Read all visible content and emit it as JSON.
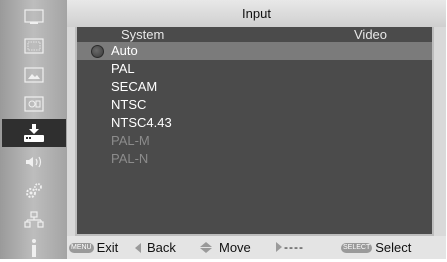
{
  "window": {
    "title": "Input"
  },
  "columns": {
    "system": "System",
    "video": "Video"
  },
  "sidebar": {
    "items": [
      {
        "icon": "display-icon"
      },
      {
        "icon": "picture-adjust-icon"
      },
      {
        "icon": "screen-icon"
      },
      {
        "icon": "image-quality-icon"
      },
      {
        "icon": "input-icon",
        "active": true
      },
      {
        "icon": "sound-icon"
      },
      {
        "icon": "settings-icon"
      },
      {
        "icon": "network-icon"
      },
      {
        "icon": "info-icon"
      }
    ]
  },
  "systems": [
    {
      "label": "Auto",
      "selected": true,
      "disabled": false
    },
    {
      "label": "PAL",
      "selected": false,
      "disabled": false
    },
    {
      "label": "SECAM",
      "selected": false,
      "disabled": false
    },
    {
      "label": "NTSC",
      "selected": false,
      "disabled": false
    },
    {
      "label": "NTSC4.43",
      "selected": false,
      "disabled": false
    },
    {
      "label": "PAL-M",
      "selected": false,
      "disabled": true
    },
    {
      "label": "PAL-N",
      "selected": false,
      "disabled": true
    }
  ],
  "help": {
    "menu_key": "MENU",
    "exit": "Exit",
    "back": "Back",
    "move": "Move",
    "next": "----",
    "select_key": "SELECT",
    "select": "Select"
  },
  "colors": {
    "panel": "#4b4b4b",
    "highlight": "#7b7b7b",
    "active_tab": "#2f2f2f",
    "disabled_text": "#8c8c8c"
  }
}
